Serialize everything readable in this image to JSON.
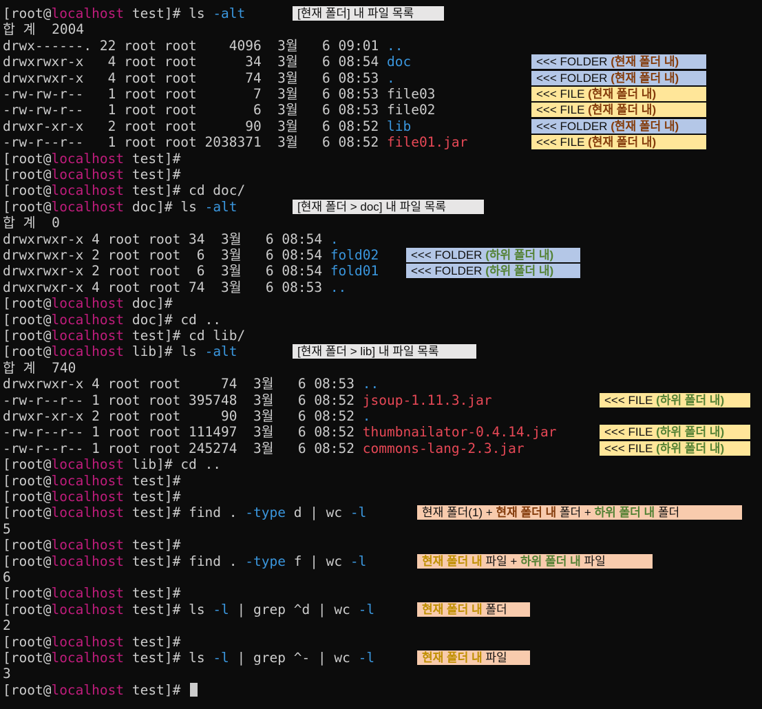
{
  "terminal": {
    "user": "[root",
    "at": "@",
    "host": "localhost",
    "lines": [
      {
        "type": "prompt",
        "dir": "test",
        "cmd": "ls ",
        "flag": "-alt"
      },
      {
        "type": "plain",
        "text": "합 계  2004"
      },
      {
        "type": "entry",
        "text": "drwx------. 22 root root    4096  3월   6 09:01 ",
        "name": "..",
        "kind": "dir"
      },
      {
        "type": "entry",
        "text": "drwxrwxr-x   4 root root      34  3월   6 08:54 ",
        "name": "doc",
        "kind": "dir"
      },
      {
        "type": "entry",
        "text": "drwxrwxr-x   4 root root      74  3월   6 08:53 ",
        "name": ".",
        "kind": "dir"
      },
      {
        "type": "entry",
        "text": "-rw-rw-r--   1 root root       7  3월   6 08:53 ",
        "name": "file03",
        "kind": "file"
      },
      {
        "type": "entry",
        "text": "-rw-rw-r--   1 root root       6  3월   6 08:53 ",
        "name": "file02",
        "kind": "file"
      },
      {
        "type": "entry",
        "text": "drwxr-xr-x   2 root root      90  3월   6 08:52 ",
        "name": "lib",
        "kind": "dir"
      },
      {
        "type": "entry",
        "text": "-rw-r--r--   1 root root 2038371  3월   6 08:52 ",
        "name": "file01.jar",
        "kind": "jar"
      },
      {
        "type": "prompt",
        "dir": "test",
        "cmd": ""
      },
      {
        "type": "prompt",
        "dir": "test",
        "cmd": ""
      },
      {
        "type": "prompt",
        "dir": "test",
        "cmd": "cd doc/"
      },
      {
        "type": "prompt",
        "dir": "doc",
        "cmd": "ls ",
        "flag": "-alt"
      },
      {
        "type": "plain",
        "text": "합 계  0"
      },
      {
        "type": "entry",
        "text": "drwxrwxr-x 4 root root 34  3월   6 08:54 ",
        "name": ".",
        "kind": "dir"
      },
      {
        "type": "entry",
        "text": "drwxrwxr-x 2 root root  6  3월   6 08:54 ",
        "name": "fold02",
        "kind": "dir"
      },
      {
        "type": "entry",
        "text": "drwxrwxr-x 2 root root  6  3월   6 08:54 ",
        "name": "fold01",
        "kind": "dir"
      },
      {
        "type": "entry",
        "text": "drwxrwxr-x 4 root root 74  3월   6 08:53 ",
        "name": "..",
        "kind": "dir"
      },
      {
        "type": "prompt",
        "dir": "doc",
        "cmd": ""
      },
      {
        "type": "prompt",
        "dir": "doc",
        "cmd": "cd .."
      },
      {
        "type": "prompt",
        "dir": "test",
        "cmd": "cd lib/"
      },
      {
        "type": "prompt",
        "dir": "lib",
        "cmd": "ls ",
        "flag": "-alt"
      },
      {
        "type": "plain",
        "text": "합 계  740"
      },
      {
        "type": "entry",
        "text": "drwxrwxr-x 4 root root     74  3월   6 08:53 ",
        "name": "..",
        "kind": "dir"
      },
      {
        "type": "entry",
        "text": "-rw-r--r-- 1 root root 395748  3월   6 08:52 ",
        "name": "jsoup-1.11.3.jar",
        "kind": "jar"
      },
      {
        "type": "entry",
        "text": "drwxr-xr-x 2 root root     90  3월   6 08:52 ",
        "name": ".",
        "kind": "dir"
      },
      {
        "type": "entry",
        "text": "-rw-r--r-- 1 root root 111497  3월   6 08:52 ",
        "name": "thumbnailator-0.4.14.jar",
        "kind": "jar"
      },
      {
        "type": "entry",
        "text": "-rw-r--r-- 1 root root 245274  3월   6 08:52 ",
        "name": "commons-lang-2.3.jar",
        "kind": "jar"
      },
      {
        "type": "prompt",
        "dir": "lib",
        "cmd": "cd .."
      },
      {
        "type": "prompt",
        "dir": "test",
        "cmd": ""
      },
      {
        "type": "prompt",
        "dir": "test",
        "cmd": ""
      },
      {
        "type": "prompt",
        "dir": "test",
        "segs": [
          {
            "t": "find . "
          },
          {
            "t": "-type",
            "c": "flag"
          },
          {
            "t": " d | wc "
          },
          {
            "t": "-l",
            "c": "flag"
          }
        ]
      },
      {
        "type": "plain",
        "text": "5"
      },
      {
        "type": "prompt",
        "dir": "test",
        "cmd": ""
      },
      {
        "type": "prompt",
        "dir": "test",
        "segs": [
          {
            "t": "find . "
          },
          {
            "t": "-type",
            "c": "flag"
          },
          {
            "t": " f | wc "
          },
          {
            "t": "-l",
            "c": "flag"
          }
        ]
      },
      {
        "type": "plain",
        "text": "6"
      },
      {
        "type": "prompt",
        "dir": "test",
        "cmd": ""
      },
      {
        "type": "prompt",
        "dir": "test",
        "segs": [
          {
            "t": "ls "
          },
          {
            "t": "-l",
            "c": "flag"
          },
          {
            "t": " | grep ^d | wc "
          },
          {
            "t": "-l",
            "c": "flag"
          }
        ]
      },
      {
        "type": "plain",
        "text": "2"
      },
      {
        "type": "prompt",
        "dir": "test",
        "cmd": ""
      },
      {
        "type": "prompt",
        "dir": "test",
        "segs": [
          {
            "t": "ls "
          },
          {
            "t": "-l",
            "c": "flag"
          },
          {
            "t": " | grep ^- | wc "
          },
          {
            "t": "-l",
            "c": "flag"
          }
        ]
      },
      {
        "type": "plain",
        "text": "3"
      },
      {
        "type": "prompt",
        "dir": "test",
        "cmd": "",
        "cursor": true
      }
    ]
  },
  "annotations": [
    {
      "line": 0,
      "style": "gray",
      "segs": [
        {
          "t": "[현재 폴더] 내 파일 목록"
        }
      ]
    },
    {
      "line": 3,
      "style": "blue",
      "segs": [
        {
          "t": "<<< FOLDER "
        },
        {
          "t": "(현재 폴더 내)",
          "c": "brown"
        }
      ]
    },
    {
      "line": 4,
      "style": "blue",
      "segs": [
        {
          "t": "<<< FOLDER "
        },
        {
          "t": "(현재 폴더 내)",
          "c": "brown"
        }
      ]
    },
    {
      "line": 5,
      "style": "yellow",
      "segs": [
        {
          "t": "<<< FILE "
        },
        {
          "t": "(현재 폴더 내)",
          "c": "brown"
        }
      ]
    },
    {
      "line": 6,
      "style": "yellow",
      "segs": [
        {
          "t": "<<< FILE "
        },
        {
          "t": "(현재 폴더 내)",
          "c": "brown"
        }
      ]
    },
    {
      "line": 7,
      "style": "blue",
      "segs": [
        {
          "t": "<<< FOLDER "
        },
        {
          "t": "(현재 폴더 내)",
          "c": "brown"
        }
      ]
    },
    {
      "line": 8,
      "style": "yellow",
      "segs": [
        {
          "t": "<<< FILE "
        },
        {
          "t": "(현재 폴더 내)",
          "c": "brown"
        }
      ]
    },
    {
      "line": 12,
      "style": "gray",
      "segs": [
        {
          "t": "[현재 폴더 > doc] 내 파일 목록"
        }
      ]
    },
    {
      "line": 15,
      "style": "blue",
      "segs": [
        {
          "t": "<<< FOLDER "
        },
        {
          "t": "(하위 폴더 내)",
          "c": "green"
        }
      ]
    },
    {
      "line": 16,
      "style": "blue",
      "segs": [
        {
          "t": "<<< FOLDER "
        },
        {
          "t": "(하위 폴더 내)",
          "c": "green"
        }
      ]
    },
    {
      "line": 21,
      "style": "gray",
      "segs": [
        {
          "t": "[현재 폴더 > lib] 내 파일 목록"
        }
      ]
    },
    {
      "line": 24,
      "style": "yellow",
      "segs": [
        {
          "t": "<<< FILE "
        },
        {
          "t": "(하위 폴더 내)",
          "c": "green"
        }
      ]
    },
    {
      "line": 26,
      "style": "yellow",
      "segs": [
        {
          "t": "<<< FILE "
        },
        {
          "t": "(하위 폴더 내)",
          "c": "green"
        }
      ]
    },
    {
      "line": 27,
      "style": "yellow",
      "segs": [
        {
          "t": "<<< FILE "
        },
        {
          "t": "(하위 폴더 내)",
          "c": "green"
        }
      ]
    },
    {
      "line": 31,
      "style": "peach",
      "segs": [
        {
          "t": "현재 폴더(1) + "
        },
        {
          "t": "현재 폴더 내",
          "c": "brown"
        },
        {
          "t": " 폴더 + "
        },
        {
          "t": "하위 폴더 내",
          "c": "green"
        },
        {
          "t": " 폴더"
        }
      ]
    },
    {
      "line": 34,
      "style": "peach",
      "segs": [
        {
          "t": "현재 폴더 내",
          "c": "gold"
        },
        {
          "t": " 파일 + "
        },
        {
          "t": "하위 폴더 내",
          "c": "green"
        },
        {
          "t": " 파일"
        }
      ]
    },
    {
      "line": 37,
      "style": "peach",
      "segs": [
        {
          "t": "현재 폴더 내",
          "c": "gold"
        },
        {
          "t": " 폴더"
        }
      ]
    },
    {
      "line": 40,
      "style": "peach",
      "segs": [
        {
          "t": "현재 폴더 내",
          "c": "gold"
        },
        {
          "t": " 파일"
        }
      ]
    }
  ],
  "colors": {
    "background": "#0c0c0c",
    "text": "#cccccc",
    "host": "#c01c7c",
    "directory": "#3a96dd",
    "archive": "#e74856",
    "note_gray": "#e7e6e6",
    "note_blue": "#b4c7e7",
    "note_yellow": "#ffe699",
    "note_peach": "#f8cbad"
  }
}
